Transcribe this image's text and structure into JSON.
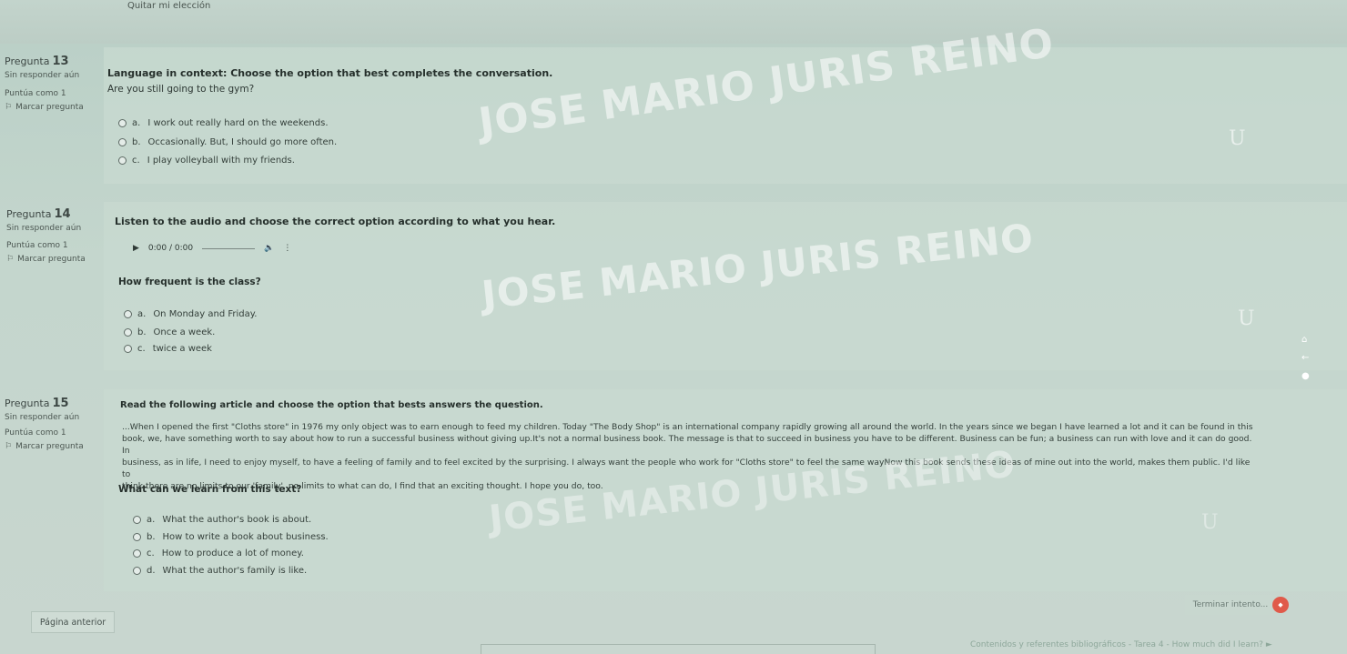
{
  "top": {
    "remove_choice": "Quitar mi elección"
  },
  "questions": [
    {
      "number_label": "Pregunta",
      "number": "13",
      "status": "Sin responder aún",
      "score": "Puntúa como 1",
      "flag_label": "Marcar pregunta",
      "prompt": "Language in context: Choose the option that best completes the conversation.",
      "text": "Are you still going to the gym?",
      "options": [
        {
          "letter": "a.",
          "text": "I work out really hard on the weekends."
        },
        {
          "letter": "b.",
          "text": "Occasionally. But, I should go more often."
        },
        {
          "letter": "c.",
          "text": "I play volleyball with my friends."
        }
      ]
    },
    {
      "number_label": "Pregunta",
      "number": "14",
      "status": "Sin responder aún",
      "score": "Puntúa como 1",
      "flag_label": "Marcar pregunta",
      "prompt": "Listen to the audio and choose the correct option according to what you hear.",
      "audio_time": "0:00 / 0:00",
      "text": "How frequent is the class?",
      "options": [
        {
          "letter": "a.",
          "text": "On Monday and Friday."
        },
        {
          "letter": "b.",
          "text": "Once a week."
        },
        {
          "letter": "c.",
          "text": "twice a week"
        }
      ]
    },
    {
      "number_label": "Pregunta",
      "number": "15",
      "status": "Sin responder aún",
      "score": "Puntúa como 1",
      "flag_label": "Marcar pregunta",
      "prompt": "Read the following article and choose the option that bests answers the question.",
      "article": [
        "...When I opened the first \"Cloths store\" in 1976 my only object was to earn enough to feed my children. Today \"The Body Shop\" is an international company rapidly growing all around the world. In the years since we began I have learned a lot and it can be found in this",
        "book, we, have something worth to say about how to run a successful business without giving up.It's not a normal business book. The message is that to succeed in business you have to be different. Business can be fun; a business can run with love and it can do good. In",
        "business, as in life, I need to enjoy myself, to have a feeling of family and to feel excited by the surprising. I always want the people who work for \"Cloths store\" to feel the same wayNow this book sends these ideas of mine out into the world, makes them public. I'd like to",
        "think there are no limits to our 'family', no limits to what can do, I find that an exciting thought. I hope you do, too."
      ],
      "text": "What can we learn from this text?",
      "options": [
        {
          "letter": "a.",
          "text": "What the author's book is about."
        },
        {
          "letter": "b.",
          "text": "How to write a book about business."
        },
        {
          "letter": "c.",
          "text": "How to produce a lot of money."
        },
        {
          "letter": "d.",
          "text": "What the author's family is like."
        }
      ]
    }
  ],
  "watermark": "JOSE MARIO JURIS REINO",
  "nav": {
    "previous": "Página anterior",
    "finish": "Terminar intento...",
    "footer_link": "Contenidos y referentes bibliográficos - Tarea 4 - How much did I learn? ►"
  },
  "colors": {
    "background": "#c4d6cd",
    "badge": "#e05a4a"
  }
}
